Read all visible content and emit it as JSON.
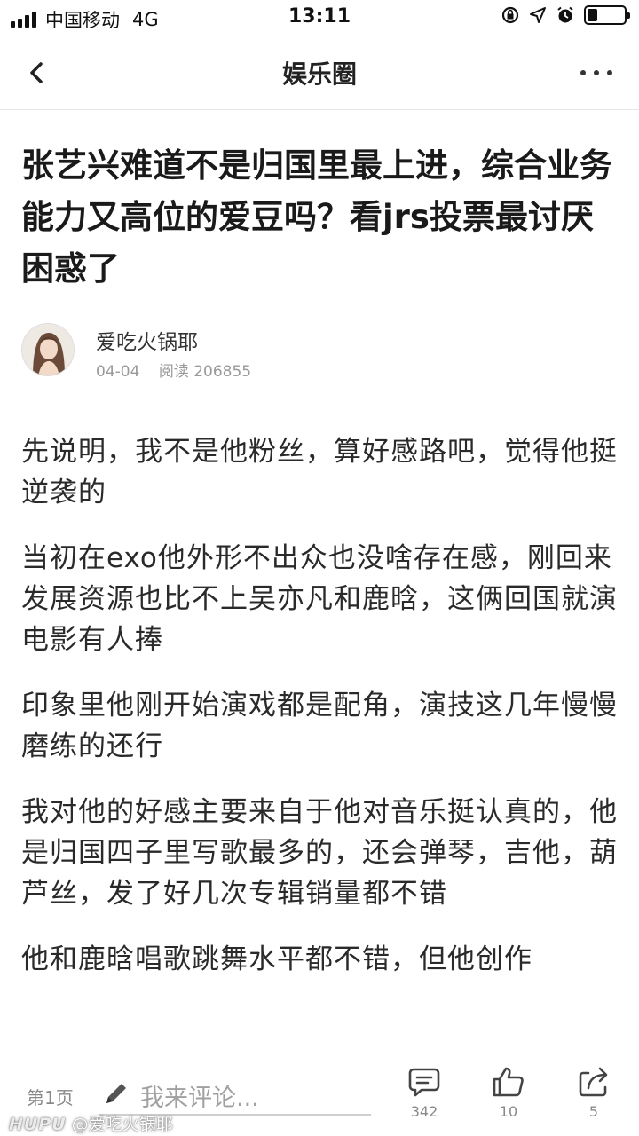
{
  "status_bar": {
    "carrier": "中国移动",
    "network": "4G",
    "time": "13:11",
    "battery_level": 0.28,
    "icons": [
      "signal-icon",
      "orientation-lock-icon",
      "location-icon",
      "alarm-icon",
      "battery-icon"
    ]
  },
  "nav": {
    "title": "娱乐圈",
    "back_icon": "chevron-left-icon",
    "more_icon": "more-dots-icon"
  },
  "post": {
    "title": "张艺兴难道不是归国里最上进，综合业务能力又高位的爱豆吗？看jrs投票最讨厌困惑了",
    "author": {
      "name": "爱吃火锅耶",
      "date": "04-04",
      "views": "阅读 206855"
    },
    "paragraphs": [
      "先说明，我不是他粉丝，算好感路吧，觉得他挺逆袭的",
      "当初在exo他外形不出众也没啥存在感，刚回来发展资源也比不上吴亦凡和鹿晗，这俩回国就演电影有人捧",
      "印象里他刚开始演戏都是配角，演技这几年慢慢磨练的还行",
      "我对他的好感主要来自于他对音乐挺认真的，他是归国四子里写歌最多的，还会弹琴，吉他，葫芦丝，发了好几次专辑销量都不错",
      "他和鹿晗唱歌跳舞水平都不错，但他创作"
    ]
  },
  "bottom_bar": {
    "page": "第1页",
    "comment_placeholder": "我来评论...",
    "reply_count": "342",
    "like_count": "10",
    "share_count": "5"
  },
  "watermark": {
    "logo": "HUPU",
    "user": "@爱吃火锅耶"
  },
  "colors": {
    "text": "#1a1a1a",
    "meta": "#999999",
    "divider": "#e6e6e6"
  }
}
